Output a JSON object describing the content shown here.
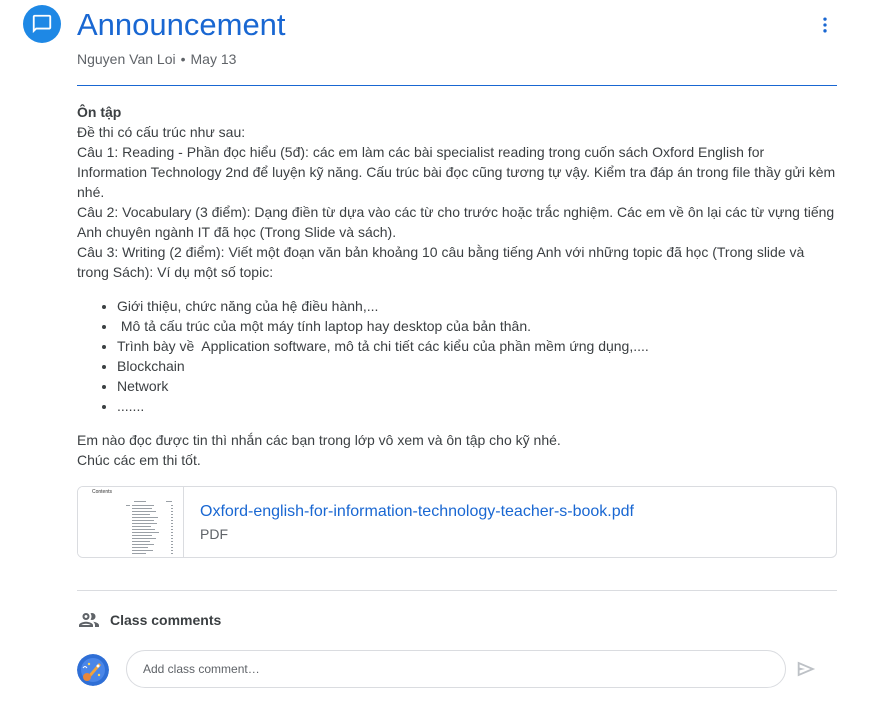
{
  "post": {
    "title": "Announcement",
    "author": "Nguyen Van Loi",
    "separator": "•",
    "date": "May 13",
    "body": {
      "heading": "Ôn tập",
      "paragraphs": [
        "Đề thi có cấu trúc như sau:",
        "Câu 1: Reading - Phần đọc hiểu (5đ): các em làm các bài specialist reading trong cuốn sách Oxford English for Information Technology 2nd để luyện kỹ năng. Cấu trúc bài đọc cũng tương tự vậy. Kiểm tra đáp án trong file thầy gửi kèm nhé.",
        "Câu 2: Vocabulary (3 điểm): Dạng điền từ dựa vào các từ cho trước hoặc trắc nghiệm. Các em về ôn lại các từ vựng tiếng Anh chuyên ngành IT đã học (Trong Slide và sách).",
        "Câu 3: Writing (2 điểm): Viết một đoạn văn bản khoảng 10 câu bằng tiếng Anh với những topic đã học (Trong slide và trong Sách): Ví dụ một số topic:"
      ],
      "list": [
        "Giới thiệu, chức năng của hệ điều hành,...",
        " Mô tả cấu trúc của một máy tính laptop hay desktop của bản thân.",
        "Trình bày về  Application software, mô tả chi tiết các kiểu của phần mềm ứng dụng,....",
        "Blockchain",
        "Network",
        "......."
      ],
      "closing": [
        "Em nào đọc được tin thì nhắn các bạn trong lớp vô xem và ôn tập cho kỹ nhé.",
        "Chúc các em thi tốt."
      ]
    },
    "attachment": {
      "title": "Oxford-english-for-information-technology-teacher-s-book.pdf",
      "type": "PDF",
      "thumbnail_heading": "Contents"
    }
  },
  "comments": {
    "label": "Class comments",
    "placeholder": "Add class comment…"
  },
  "icons": {
    "announcement": "announcement-icon",
    "more": "more-vert-icon",
    "people": "people-icon",
    "send": "send-icon"
  },
  "colors": {
    "accent": "#1967d2",
    "avatar_bg": "#1e88e5",
    "text": "#3c4043",
    "muted": "#5f6368",
    "border": "#dadce0"
  }
}
